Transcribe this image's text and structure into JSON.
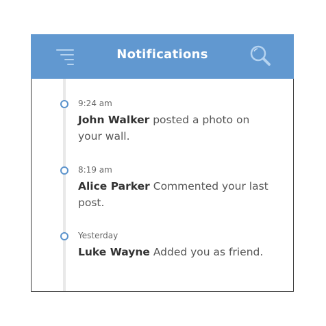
{
  "header": {
    "title": "Notifications",
    "menu_icon": "filter-menu-icon",
    "search_icon": "search-icon",
    "bg_color": "#6198d0"
  },
  "notifications": [
    {
      "time": "9:24 am",
      "name": "John Walker",
      "message": "posted a photo on your wall."
    },
    {
      "time": "8:19 am",
      "name": "Alice Parker",
      "message": "Commented your last post."
    },
    {
      "time": "Yesterday",
      "name": "Luke Wayne",
      "message": "Added you as friend."
    }
  ],
  "colors": {
    "accent": "#6198d0",
    "dot": "#5b93cc",
    "timeline": "#e9e9e9"
  }
}
